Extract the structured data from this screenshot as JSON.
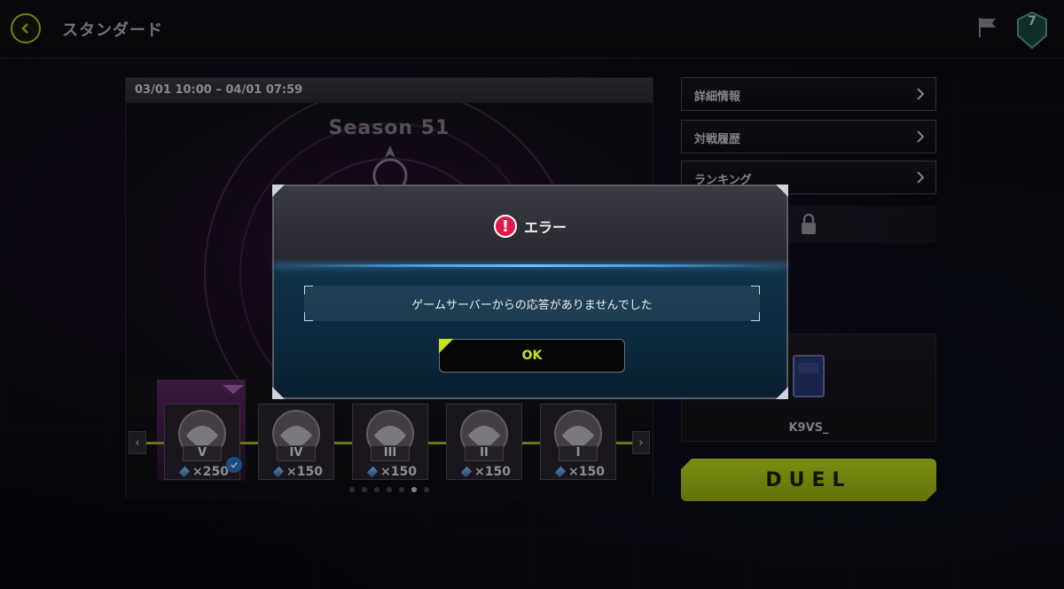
{
  "header": {
    "title": "スタンダード",
    "level": "7"
  },
  "season": {
    "date_range": "03/01 10:00 – 04/01 07:59",
    "title": "Season 51"
  },
  "ranks": [
    {
      "numeral": "V",
      "cost": "×250",
      "claimed": true
    },
    {
      "numeral": "IV",
      "cost": "×150"
    },
    {
      "numeral": "III",
      "cost": "×150"
    },
    {
      "numeral": "II",
      "cost": "×150"
    },
    {
      "numeral": "I",
      "cost": "×150"
    }
  ],
  "pager": {
    "count": 7,
    "active": 5
  },
  "menu": {
    "details": "詳細情報",
    "history": "対戦履歴",
    "ranking": "ランキング"
  },
  "deck": {
    "name": "K9VS_"
  },
  "duel_label": "DUEL",
  "dialog": {
    "title": "エラー",
    "message": "ゲームサーバーからの応答がありませんでした",
    "ok_label": "OK"
  },
  "colors": {
    "accent": "#c7e41a",
    "error": "#e0194a",
    "dialog_glow": "#49a6ea"
  }
}
